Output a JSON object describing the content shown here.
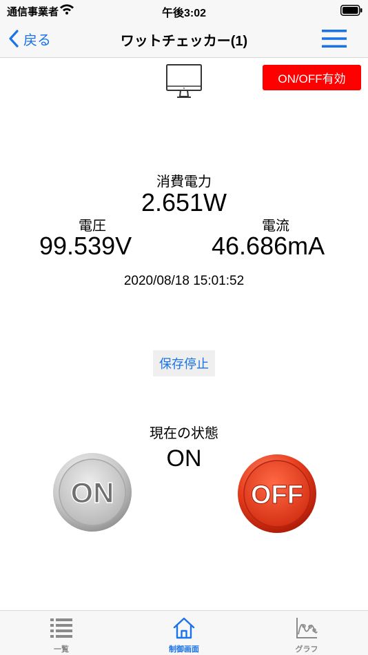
{
  "status_bar": {
    "carrier": "通信事業者",
    "time": "午後3:02"
  },
  "nav": {
    "back_label": "戻る",
    "title": "ワットチェッカー(1)"
  },
  "device": {
    "icon": "monitor-icon",
    "onoff_badge": "ON/OFF有効"
  },
  "measurements": {
    "power_label": "消費電力",
    "power_value": "2.651W",
    "voltage_label": "電圧",
    "voltage_value": "99.539V",
    "current_label": "電流",
    "current_value": "46.686mA",
    "timestamp": "2020/08/18 15:01:52"
  },
  "actions": {
    "save_stop_label": "保存停止"
  },
  "state": {
    "label": "現在の状態",
    "value": "ON",
    "on_button_text": "ON",
    "off_button_text": "OFF"
  },
  "tabs": [
    {
      "label": "一覧",
      "icon": "list-icon",
      "active": false
    },
    {
      "label": "制御画面",
      "icon": "home-icon",
      "active": true
    },
    {
      "label": "グラフ",
      "icon": "graph-icon",
      "active": false
    }
  ],
  "colors": {
    "accent": "#1a73e8",
    "badge_red": "#ff0000",
    "inactive_tab": "#888888"
  }
}
